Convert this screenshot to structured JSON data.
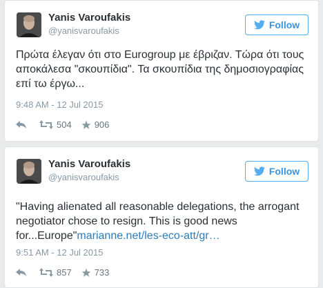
{
  "colors": {
    "accent": "#55acee",
    "link": "#2b7bb9",
    "muted": "#8899a6"
  },
  "icons": {
    "follow": "twitter-bird-icon",
    "reply": "reply-arrow-icon",
    "retweet": "retweet-icon",
    "favorite": "star-icon"
  },
  "tweets": [
    {
      "name": "Yanis Varoufakis",
      "handle": "@yanisvaroufakis",
      "follow_label": "Follow",
      "text": "Πρώτα έλεγαν ότι στο Eurogroup με έβριζαν. Τώρα ότι τους αποκάλεσα \"σκουπίδια\". Τα σκουπίδια της δημοσιογραφίας επί τω έργω...",
      "timestamp": "9:48 AM - 12 Jul 2015",
      "retweets": "504",
      "favorites": "906"
    },
    {
      "name": "Yanis Varoufakis",
      "handle": "@yanisvaroufakis",
      "follow_label": "Follow",
      "text": "\"Having alienated all reasonable delegations, the arrogant negotiator chose to resign. This is good news for...Europe\"",
      "link": "marianne.net/les-eco-att/gr…",
      "timestamp": "9:51 AM - 12 Jul 2015",
      "retweets": "857",
      "favorites": "733"
    }
  ]
}
